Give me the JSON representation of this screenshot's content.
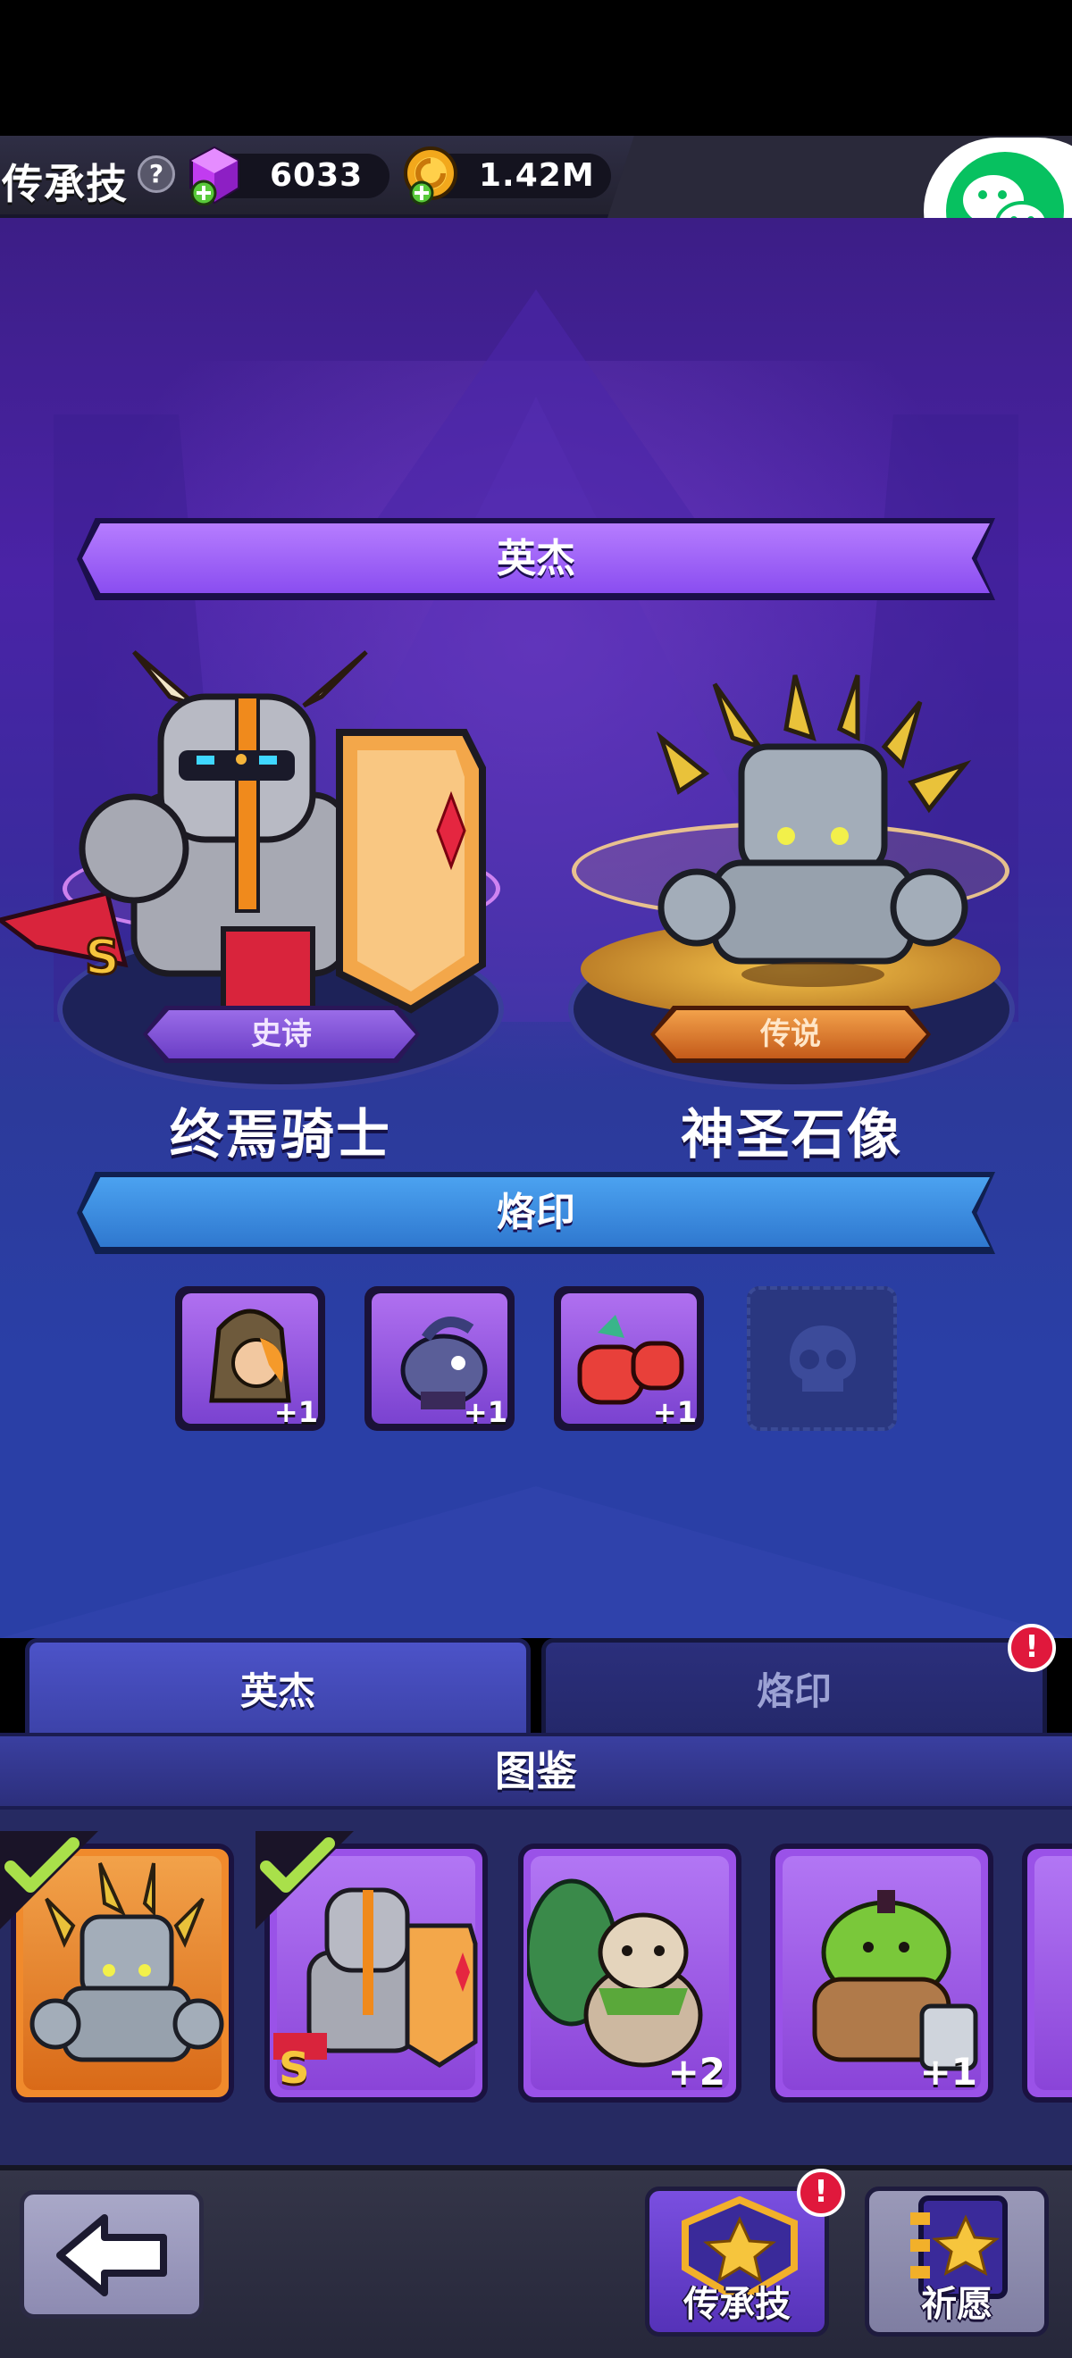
{
  "top_bar": {
    "page_title": "传承技",
    "gems": "6033",
    "gold": "1.42M"
  },
  "hero_section": {
    "banner": "英杰",
    "heroes": [
      {
        "name": "终焉骑士",
        "rarity": "史诗",
        "grade": "S"
      },
      {
        "name": "神圣石像",
        "rarity": "传说"
      }
    ]
  },
  "seal_section": {
    "banner": "烙印",
    "slots": [
      {
        "bonus": "+1"
      },
      {
        "bonus": "+1"
      },
      {
        "bonus": "+1"
      },
      {
        "bonus": ""
      }
    ]
  },
  "tabs": [
    {
      "label": "英杰",
      "active": true
    },
    {
      "label": "烙印",
      "active": false,
      "alert": "!"
    }
  ],
  "codex": {
    "title": "图鉴",
    "cards": [
      {
        "owned": true,
        "bonus": ""
      },
      {
        "owned": true,
        "bonus": "",
        "grade": "S"
      },
      {
        "owned": false,
        "bonus": "+2"
      },
      {
        "owned": false,
        "bonus": "+1"
      }
    ]
  },
  "bottom_nav": {
    "legacy_label": "传承技",
    "legacy_alert": "!",
    "wish_label": "祈愿"
  }
}
